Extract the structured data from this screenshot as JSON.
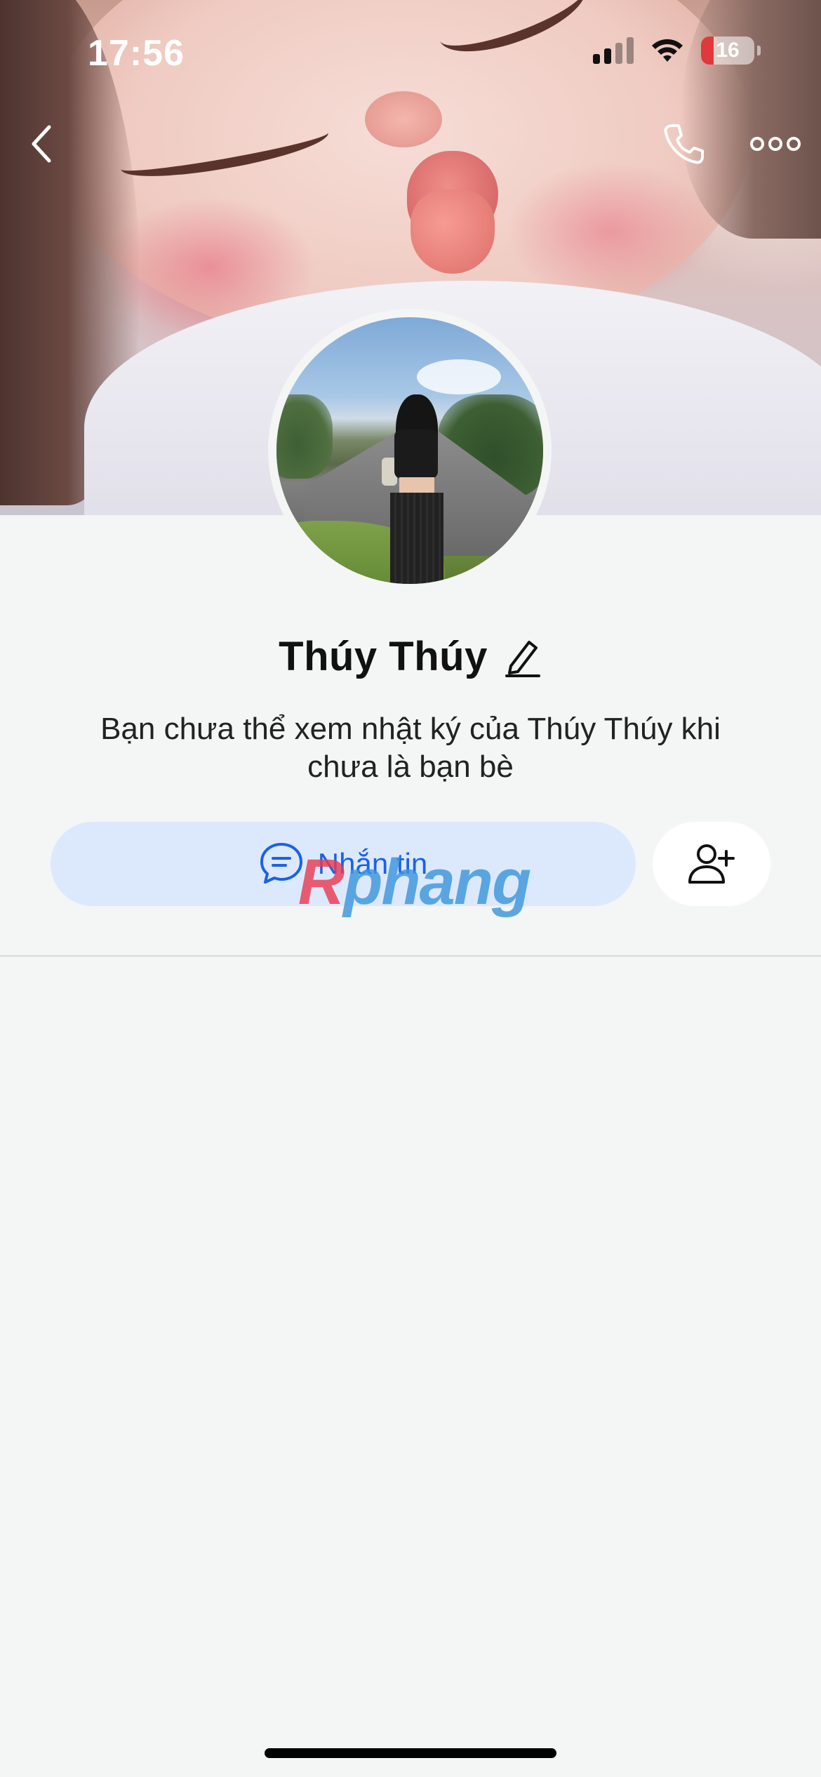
{
  "status_bar": {
    "time": "17:56",
    "battery": "16"
  },
  "nav": {
    "back_icon": "chevron-left-icon",
    "call_icon": "phone-icon",
    "more_icon": "more-horizontal-icon"
  },
  "profile": {
    "name": "Thúy Thúy",
    "edit_icon": "pencil-icon",
    "info": "Bạn chưa thể xem nhật ký của Thúy Thúy khi chưa là bạn bè"
  },
  "actions": {
    "message_label": "Nhắn tin",
    "message_icon": "chat-bubble-icon",
    "add_friend_icon": "add-friend-icon"
  },
  "watermark": {
    "first": "R",
    "rest": "phang"
  },
  "colors": {
    "background": "#f4f5f5",
    "message_button_bg": "#dce9fd",
    "message_button_text": "#1a62e6"
  }
}
